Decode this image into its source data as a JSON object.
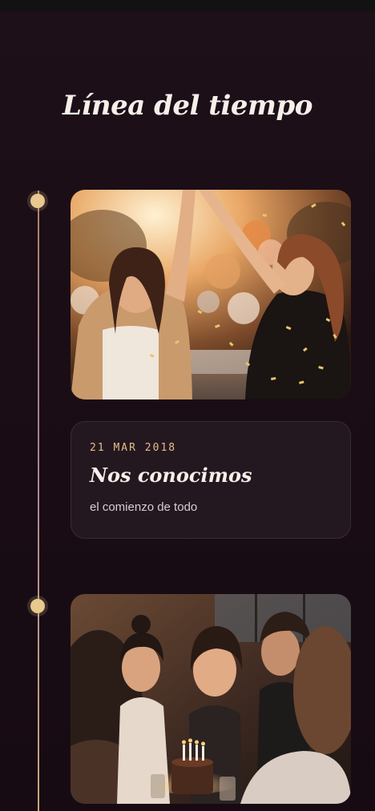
{
  "header": {
    "title": "Línea del tiempo"
  },
  "timeline": {
    "events": [
      {
        "date": "21 MAR 2018",
        "title": "Nos conocimos",
        "subtitle": "el comienzo de todo"
      }
    ]
  },
  "colors": {
    "background": "#1b0e16",
    "accent": "#e8c98e",
    "card": "#241820",
    "date_text": "#e5bc86"
  },
  "icons": {
    "timeline_marker": "timeline-dot-icon"
  }
}
